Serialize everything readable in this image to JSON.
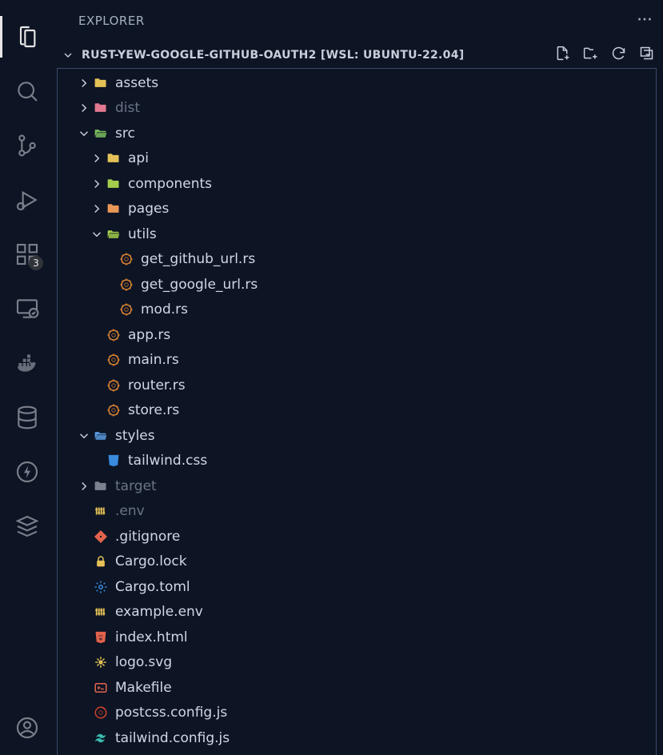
{
  "explorer": {
    "title": "EXPLORER",
    "section_title": "RUST-YEW-GOOGLE-GITHUB-OAUTH2 [WSL: UBUNTU-22.04]"
  },
  "activity": {
    "extensions_badge": "3"
  },
  "tree": [
    {
      "depth": 0,
      "kind": "folder",
      "state": "closed",
      "icon": "folder-yellow",
      "label": "assets",
      "dim": false
    },
    {
      "depth": 0,
      "kind": "folder",
      "state": "closed",
      "icon": "folder-pink",
      "label": "dist",
      "dim": true
    },
    {
      "depth": 0,
      "kind": "folder",
      "state": "open",
      "icon": "folder-green",
      "label": "src",
      "dim": false
    },
    {
      "depth": 1,
      "kind": "folder",
      "state": "closed",
      "icon": "folder-yellow",
      "label": "api",
      "dim": false
    },
    {
      "depth": 1,
      "kind": "folder",
      "state": "closed",
      "icon": "folder-lime",
      "label": "components",
      "dim": false
    },
    {
      "depth": 1,
      "kind": "folder",
      "state": "closed",
      "icon": "folder-orange",
      "label": "pages",
      "dim": false
    },
    {
      "depth": 1,
      "kind": "folder",
      "state": "open",
      "icon": "folder-lime",
      "label": "utils",
      "dim": false
    },
    {
      "depth": 2,
      "kind": "file",
      "icon": "rust",
      "label": "get_github_url.rs"
    },
    {
      "depth": 2,
      "kind": "file",
      "icon": "rust",
      "label": "get_google_url.rs"
    },
    {
      "depth": 2,
      "kind": "file",
      "icon": "rust",
      "label": "mod.rs"
    },
    {
      "depth": 1,
      "kind": "file",
      "icon": "rust",
      "label": "app.rs"
    },
    {
      "depth": 1,
      "kind": "file",
      "icon": "rust",
      "label": "main.rs"
    },
    {
      "depth": 1,
      "kind": "file",
      "icon": "rust",
      "label": "router.rs"
    },
    {
      "depth": 1,
      "kind": "file",
      "icon": "rust",
      "label": "store.rs"
    },
    {
      "depth": 0,
      "kind": "folder",
      "state": "open",
      "icon": "folder-blue",
      "label": "styles",
      "dim": false
    },
    {
      "depth": 1,
      "kind": "file",
      "icon": "css",
      "label": "tailwind.css"
    },
    {
      "depth": 0,
      "kind": "folder",
      "state": "closed",
      "icon": "folder-gray",
      "label": "target",
      "dim": true
    },
    {
      "depth": 0,
      "kind": "file",
      "icon": "env",
      "label": ".env",
      "dim": true
    },
    {
      "depth": 0,
      "kind": "file",
      "icon": "git",
      "label": ".gitignore"
    },
    {
      "depth": 0,
      "kind": "file",
      "icon": "lock",
      "label": "Cargo.lock"
    },
    {
      "depth": 0,
      "kind": "file",
      "icon": "gear",
      "label": "Cargo.toml"
    },
    {
      "depth": 0,
      "kind": "file",
      "icon": "env",
      "label": "example.env"
    },
    {
      "depth": 0,
      "kind": "file",
      "icon": "html",
      "label": "index.html"
    },
    {
      "depth": 0,
      "kind": "file",
      "icon": "svg",
      "label": "logo.svg"
    },
    {
      "depth": 0,
      "kind": "file",
      "icon": "make",
      "label": "Makefile"
    },
    {
      "depth": 0,
      "kind": "file",
      "icon": "postcss",
      "label": "postcss.config.js"
    },
    {
      "depth": 0,
      "kind": "file",
      "icon": "tailwind",
      "label": "tailwind.config.js"
    }
  ],
  "icon_colors": {
    "folder-yellow": "#e4c157",
    "folder-pink": "#e07890",
    "folder-green": "#7bbd5d",
    "folder-lime": "#a3cd4b",
    "folder-orange": "#e89757",
    "folder-blue": "#5a9be0",
    "folder-gray": "#7a8290",
    "rust": "#d98232",
    "css": "#3a8bdd",
    "env": "#e4c157",
    "git": "#e2634c",
    "lock": "#e4c157",
    "gear": "#3a8bdd",
    "html": "#e2634c",
    "svg": "#e4c157",
    "make": "#e2634c",
    "postcss": "#c9412b",
    "tailwind": "#3bbbb0"
  }
}
